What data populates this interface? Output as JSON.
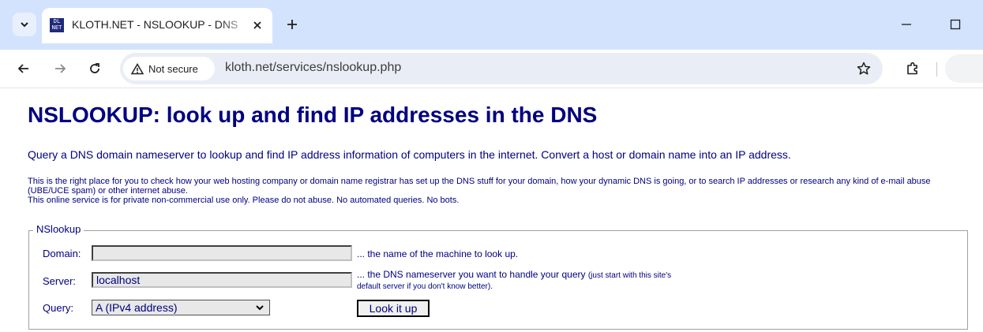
{
  "browser": {
    "tab": {
      "title": "KLOTH.NET - NSLOOKUP - DNS",
      "favicon_text": "DL\nNET"
    },
    "toolbar": {
      "security_label": "Not secure",
      "url": "kloth.net/services/nslookup.php"
    },
    "icons": {
      "tab_menu": "chevron-down-icon",
      "close": "close-icon",
      "new_tab": "plus-icon",
      "minimize": "minimize-icon",
      "maximize": "maximize-icon",
      "back": "arrow-left-icon",
      "forward": "arrow-right-icon",
      "reload": "reload-icon",
      "warning": "warning-triangle-icon",
      "bookmark": "star-icon",
      "extensions": "puzzle-icon"
    }
  },
  "page": {
    "title": "NSLOOKUP: look up and find IP addresses in the DNS",
    "intro": "Query a DNS domain nameserver to lookup and find IP address information of computers in the internet. Convert a host or domain name into an IP address.",
    "description_1": "This is the right place for you to check how your web hosting company or domain name registrar has set up the DNS stuff for your domain, how your dynamic DNS is going, or to search IP addresses or research any kind of e-mail abuse (UBE/UCE spam) or other internet abuse.",
    "description_2": "This online service is for private non-commercial use only. Please do not abuse. No automated queries. No bots.",
    "colors": {
      "text": "#000080",
      "background": "#ffffff"
    }
  },
  "form": {
    "legend": "NSlookup",
    "domain": {
      "label": "Domain:",
      "value": "",
      "hint": "... the name of the machine to look up."
    },
    "server": {
      "label": "Server:",
      "value": "localhost",
      "hint": "... the DNS nameserver you want to handle your query",
      "hint_small_1": "(just start with this site's",
      "hint_small_2": "default server if you don't know better)."
    },
    "query": {
      "label": "Query:",
      "selected": "A (IPv4 address)"
    },
    "submit_label": "Look it up"
  }
}
